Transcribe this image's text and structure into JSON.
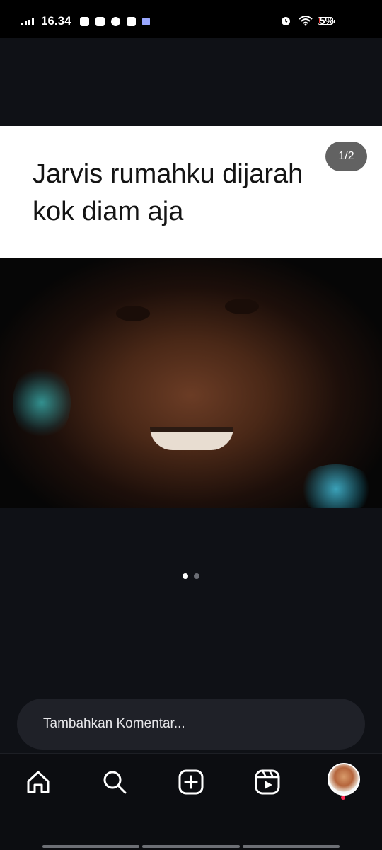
{
  "status_bar": {
    "time": "16.34",
    "battery_percent": "5%",
    "battery_level": 0.05,
    "notification_icons": [
      "youtube-icon",
      "gmail-icon",
      "messenger-icon",
      "facebook-icon",
      "app-icon"
    ],
    "status_icons": [
      "alarm-icon",
      "wifi-icon"
    ]
  },
  "post": {
    "caption": "Jarvis rumahku dijarah kok diam aja",
    "counter": "1/2",
    "carousel_total": 2,
    "carousel_active": 1
  },
  "comment": {
    "placeholder": "Tambahkan Komentar..."
  },
  "bottom_nav": {
    "items": [
      "home-icon",
      "search-icon",
      "create-icon",
      "reels-icon",
      "profile-avatar"
    ]
  },
  "colors": {
    "background": "#0f1116",
    "comment_bar": "#1f2128",
    "dot_active": "#ffffff",
    "dot_inactive": "#6b6e75",
    "badge": "#ff2d55"
  }
}
